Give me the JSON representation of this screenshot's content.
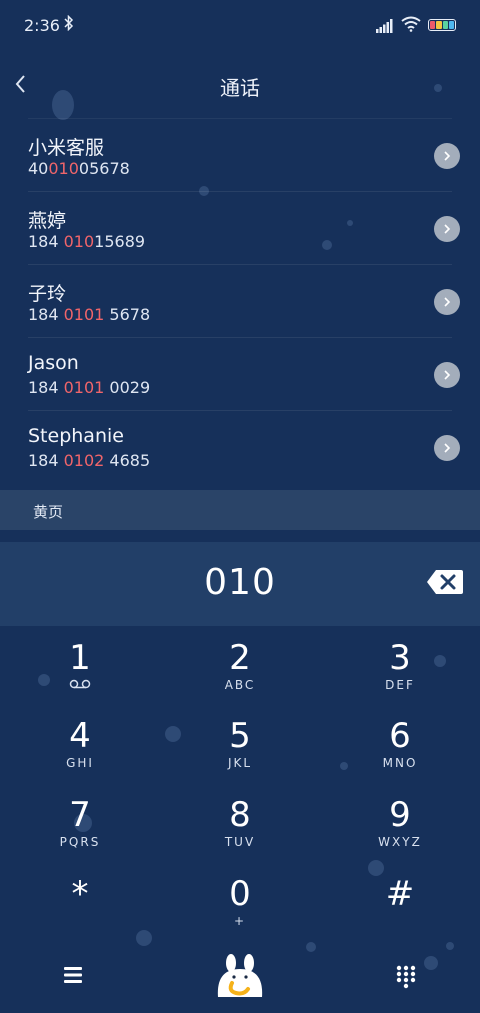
{
  "status_bar": {
    "time": "2:36"
  },
  "header": {
    "title": "通话"
  },
  "contacts": [
    {
      "name": "小米客服",
      "pre": "40",
      "match": "010",
      "post": "05678"
    },
    {
      "name": "燕婷",
      "pre": "184 ",
      "match": "010",
      "post": "15689"
    },
    {
      "name": "子玲",
      "pre": "184 ",
      "match": "0101",
      "post": " 5678"
    },
    {
      "name": "Jason",
      "pre": "184 ",
      "match": "0101",
      "post": " 0029"
    },
    {
      "name": "Stephanie",
      "pre": "184 ",
      "match": "0102",
      "post": " 4685"
    }
  ],
  "section": {
    "label": "黄页"
  },
  "dialer": {
    "input": "010"
  },
  "keypad": [
    {
      "digit": "1",
      "letters": ""
    },
    {
      "digit": "2",
      "letters": "ABC"
    },
    {
      "digit": "3",
      "letters": "DEF"
    },
    {
      "digit": "4",
      "letters": "GHI"
    },
    {
      "digit": "5",
      "letters": "JKL"
    },
    {
      "digit": "6",
      "letters": "MNO"
    },
    {
      "digit": "7",
      "letters": "PQRS"
    },
    {
      "digit": "8",
      "letters": "TUV"
    },
    {
      "digit": "9",
      "letters": "WXYZ"
    },
    {
      "digit": "*",
      "letters": ""
    },
    {
      "digit": "0",
      "letters": "+"
    },
    {
      "digit": "#",
      "letters": ""
    }
  ],
  "colors": {
    "background": "#16305a",
    "highlight": "#f0656a",
    "section_bg": "#2a4468",
    "display_bg": "#223f68",
    "mascot": "#f5b21a"
  },
  "icons": {
    "back": "chevron-left-icon",
    "delete": "backspace-icon",
    "voicemail": "voicemail-icon",
    "menu": "menu-icon",
    "call": "call-mascot-icon",
    "keypad": "dialpad-icon"
  }
}
